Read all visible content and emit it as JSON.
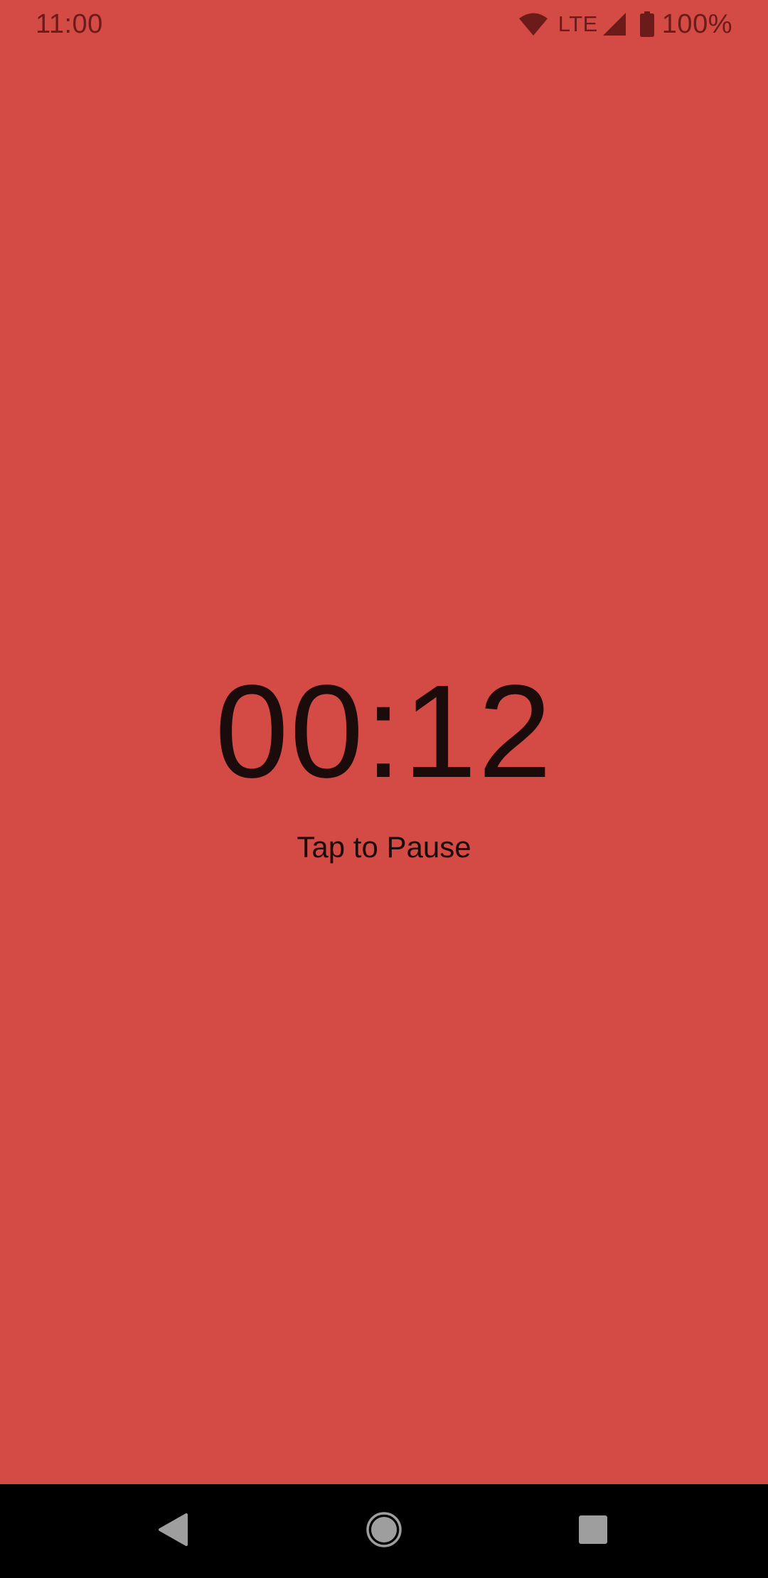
{
  "colors": {
    "background": "#d44a45",
    "status_icons": "#6b1c1a",
    "timer_text": "#1c0b0b",
    "nav_bar": "#000000",
    "nav_icons": "#9e9e9e"
  },
  "status_bar": {
    "time": "11:00",
    "network": "LTE",
    "battery": "100%",
    "icons": [
      "wifi-icon",
      "cell-signal-icon",
      "battery-icon"
    ]
  },
  "timer": {
    "value": "00:12",
    "hint": "Tap to Pause"
  },
  "nav_bar": {
    "buttons": [
      "back-icon",
      "home-icon",
      "recents-icon"
    ]
  }
}
